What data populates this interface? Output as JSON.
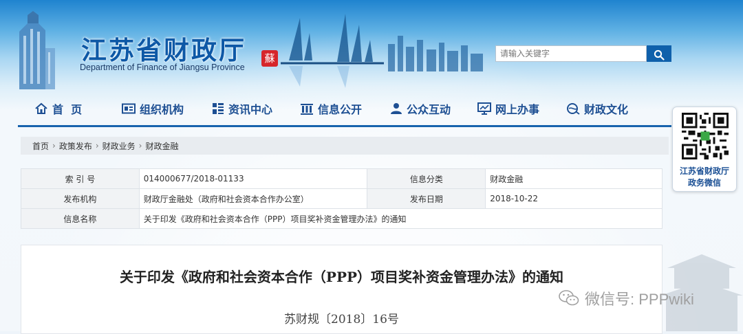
{
  "header": {
    "site_title": "江苏省财政厅",
    "site_subtitle": "Department of Finance of Jiangsu Province",
    "seal_char": "蘇",
    "search": {
      "placeholder": "请输入关键字",
      "icon": "search-icon"
    }
  },
  "nav": {
    "items": [
      {
        "label": "首  页",
        "icon": "home-icon"
      },
      {
        "label": "组织机构",
        "icon": "id-card-icon"
      },
      {
        "label": "资讯中心",
        "icon": "grid-icon"
      },
      {
        "label": "信息公开",
        "icon": "columns-icon"
      },
      {
        "label": "公众互动",
        "icon": "user-icon"
      },
      {
        "label": "网上办事",
        "icon": "monitor-icon"
      },
      {
        "label": "财政文化",
        "icon": "globe-icon"
      }
    ],
    "accent_color": "#1763ad"
  },
  "breadcrumb": [
    "首页",
    "政策发布",
    "财政业务",
    "财政金融"
  ],
  "info": {
    "index_label": "索 引 号",
    "index_value": "014000677/2018-01133",
    "category_label": "信息分类",
    "category_value": "财政金融",
    "publisher_label": "发布机构",
    "publisher_value": "财政厅金融处（政府和社会资本合作办公室）",
    "date_label": "发布日期",
    "date_value": "2018-10-22",
    "name_label": "信息名称",
    "name_value": "关于印发《政府和社会资本合作（PPP）项目奖补资金管理办法》的通知"
  },
  "document": {
    "title": "关于印发《政府和社会资本合作（PPP）项目奖补资金管理办法》的通知",
    "number": "苏财规〔2018〕16号"
  },
  "qr_widget": {
    "line1": "江苏省财政厅",
    "line2": "政务微信"
  },
  "watermark": "微信号: PPPwiki",
  "colors": {
    "brand_blue": "#0d58a6",
    "nav_text": "#1d4f93",
    "search_button": "#0f60ab",
    "seal_red": "#d6262b"
  }
}
